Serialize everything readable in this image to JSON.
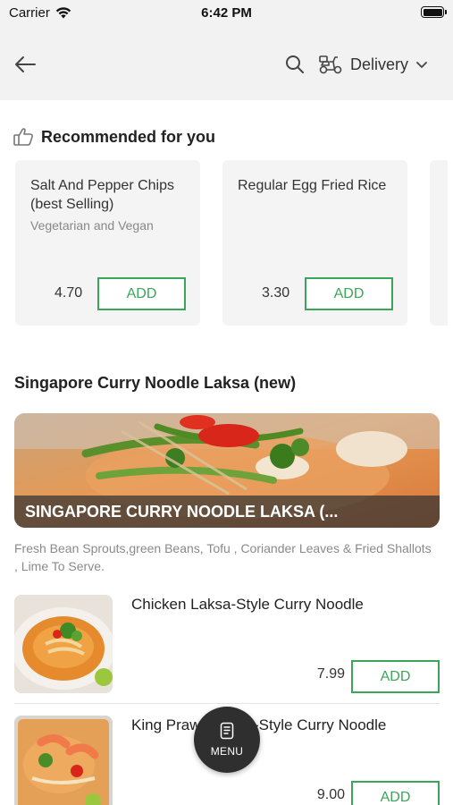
{
  "status_bar": {
    "carrier": "Carrier",
    "time": "6:42 PM",
    "battery_level": 1.0
  },
  "header": {
    "back_icon": "arrow-left-icon",
    "search_icon": "search-icon",
    "delivery_icon": "scooter-icon",
    "delivery_label": "Delivery",
    "dropdown_icon": "chevron-down-icon"
  },
  "recommended": {
    "icon": "thumbs-up-icon",
    "title": "Recommended for you",
    "items": [
      {
        "name": "Salt And Pepper Chips (best Selling)",
        "subtitle": "Vegetarian and Vegan",
        "price": "4.70",
        "add_label": "ADD"
      },
      {
        "name": "Regular Egg Fried Rice",
        "subtitle": "",
        "price": "3.30",
        "add_label": "ADD"
      }
    ]
  },
  "section": {
    "title": "Singapore Curry Noodle Laksa (new)",
    "banner_caption": "SINGAPORE CURRY NOODLE LAKSA (...",
    "description": "Fresh Bean Sprouts,green Beans, Tofu , Coriander Leaves & Fried Shallots , Lime To Serve.",
    "items": [
      {
        "name": "Chicken Laksa-Style Curry Noodle",
        "price": "7.99",
        "add_label": "ADD"
      },
      {
        "name": "King Prawn Laksa-Style Curry Noodle",
        "price": "9.00",
        "add_label": "ADD"
      }
    ]
  },
  "fab": {
    "icon": "menu-book-icon",
    "label": "MENU"
  },
  "colors": {
    "accent": "#3ba659",
    "header_bg": "#f2f2f2",
    "card_bg": "#f4f4f4",
    "fab_bg": "#2f2f2f"
  }
}
